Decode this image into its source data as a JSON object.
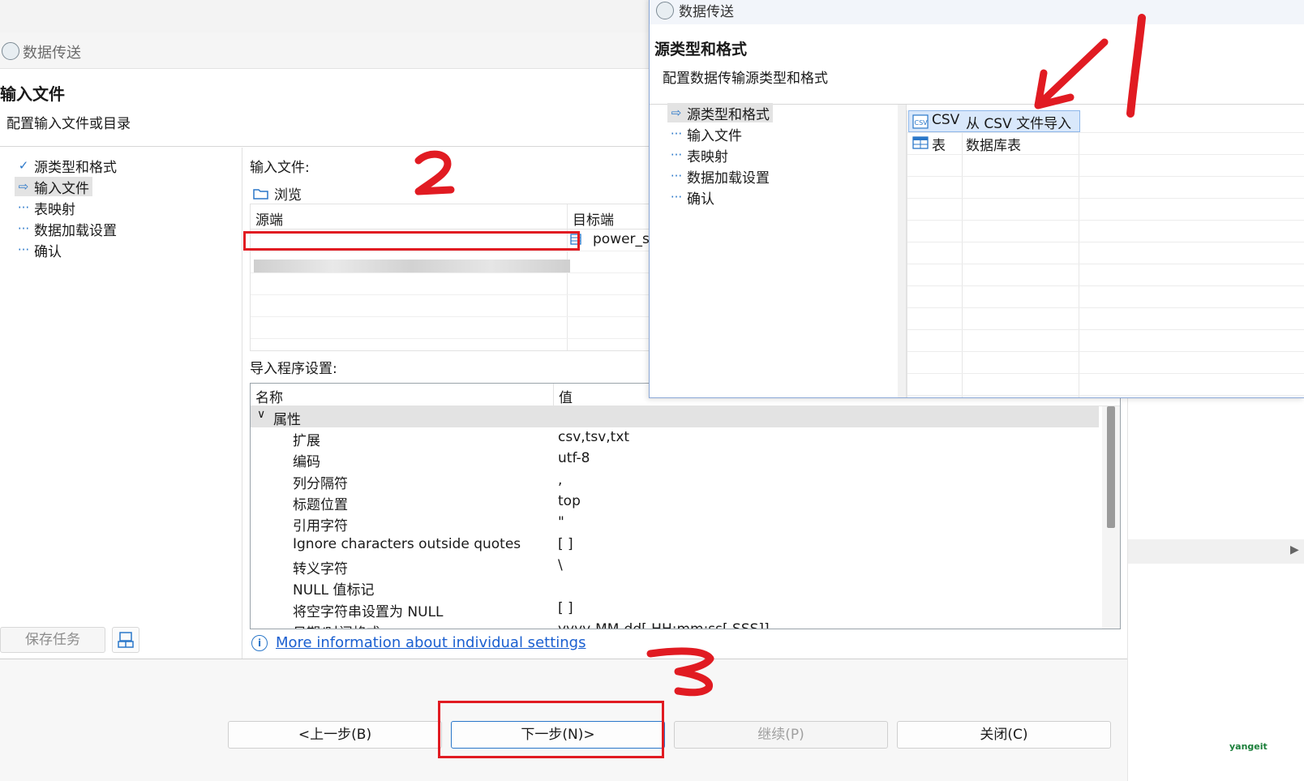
{
  "background_dialog": {
    "top_strip_text": "",
    "window_title": "数据传送",
    "page_title": "输入文件",
    "page_description": "配置输入文件或目录",
    "nav": [
      {
        "label": "源类型和格式",
        "icon": "check-icon"
      },
      {
        "label": "输入文件",
        "icon": "arrow-right-icon",
        "selected": true
      },
      {
        "label": "表映射",
        "icon": "dots-icon"
      },
      {
        "label": "数据加载设置",
        "icon": "dots-icon"
      },
      {
        "label": "确认",
        "icon": "dots-icon"
      }
    ],
    "save_task_label": "保存任务",
    "input_file_label": "输入文件:",
    "browse_label": "浏览",
    "file_table": {
      "headers": [
        "源端",
        "目标端"
      ],
      "rows": [
        {
          "source": "",
          "target": "power_s"
        }
      ]
    },
    "importer_settings_label": "导入程序设置:",
    "properties": {
      "headers": [
        "名称",
        "值"
      ],
      "group": "属性",
      "rows": [
        {
          "name": "扩展",
          "value": "csv,tsv,txt"
        },
        {
          "name": "编码",
          "value": "utf-8"
        },
        {
          "name": "列分隔符",
          "value": ","
        },
        {
          "name": "标题位置",
          "value": "top"
        },
        {
          "name": "引用字符",
          "value": "\""
        },
        {
          "name": "Ignore characters outside quotes",
          "value": "[ ]"
        },
        {
          "name": "转义字符",
          "value": "\\"
        },
        {
          "name": "NULL 值标记",
          "value": ""
        },
        {
          "name": "将空字符串设置为 NULL",
          "value": "[ ]"
        },
        {
          "name": "日期/时间格式",
          "value": "yyyy-MM-dd[ HH:mm:ss[.SSS]]"
        }
      ]
    },
    "info_link": "More information about individual settings",
    "buttons": {
      "back": "<上一步(B)",
      "next": "下一步(N)>",
      "continue": "继续(P)",
      "close": "关闭(C)"
    }
  },
  "front_dialog": {
    "window_title": "数据传送",
    "page_title": "源类型和格式",
    "page_description": "配置数据传输源类型和格式",
    "nav": [
      {
        "label": "源类型和格式",
        "icon": "arrow-right-icon",
        "selected": true
      },
      {
        "label": "输入文件",
        "icon": "dots-icon"
      },
      {
        "label": "表映射",
        "icon": "dots-icon"
      },
      {
        "label": "数据加载设置",
        "icon": "dots-icon"
      },
      {
        "label": "确认",
        "icon": "dots-icon"
      }
    ],
    "source_types": [
      {
        "name": "CSV",
        "description": "从 CSV 文件导入",
        "icon": "csv-file-icon",
        "selected": true
      },
      {
        "name": "表",
        "description": "数据库表",
        "icon": "table-icon"
      }
    ]
  },
  "annotations": {
    "step1": "1",
    "step2": "2",
    "step3": "3",
    "color": "#e11b22"
  },
  "watermark": "yangeit"
}
